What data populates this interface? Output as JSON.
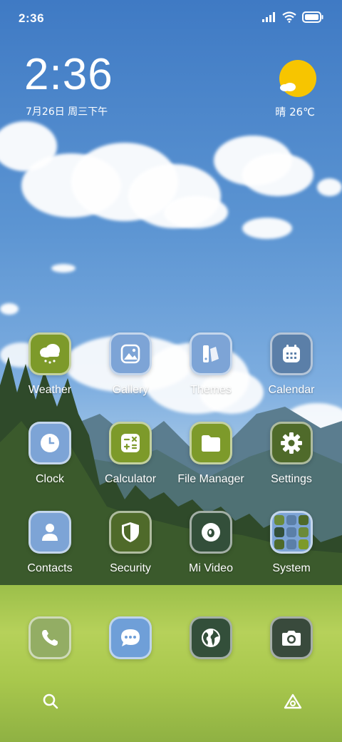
{
  "status_bar": {
    "time": "2:36",
    "icons": [
      "signal-icon",
      "wifi-icon",
      "battery-icon"
    ]
  },
  "clock_widget": {
    "time": "2:36",
    "date": "7月26日 周三下午"
  },
  "weather_widget": {
    "condition_icon": "sun-cloud-icon",
    "text": "晴 26℃"
  },
  "apps": [
    {
      "label": "Weather",
      "icon": "weather-icon",
      "color": "#7d9a2a"
    },
    {
      "label": "Gallery",
      "icon": "gallery-icon",
      "color": "#7da4d6"
    },
    {
      "label": "Themes",
      "icon": "themes-icon",
      "color": "#7da4d6"
    },
    {
      "label": "Calendar",
      "icon": "calendar-icon",
      "color": "#5b7fa8"
    },
    {
      "label": "Clock",
      "icon": "clock-icon",
      "color": "#7da4d6"
    },
    {
      "label": "Calculator",
      "icon": "calculator-icon",
      "color": "#7d9a2a"
    },
    {
      "label": "File Manager",
      "icon": "folder-icon",
      "color": "#7d9a2a"
    },
    {
      "label": "Settings",
      "icon": "gear-icon",
      "color": "#4f6a2a"
    },
    {
      "label": "Contacts",
      "icon": "contacts-icon",
      "color": "#7da4d6"
    },
    {
      "label": "Security",
      "icon": "shield-icon",
      "color": "#4f6a2a"
    },
    {
      "label": "Mi Video",
      "icon": "video-icon",
      "color": "#334f3a"
    },
    {
      "label": "System",
      "icon": "folder-grid-icon",
      "color": "#7da4d6"
    }
  ],
  "dock": [
    {
      "icon": "phone-icon",
      "color": "#93ad64"
    },
    {
      "icon": "messages-icon",
      "color": "#6f9fd8"
    },
    {
      "icon": "browser-globe-icon",
      "color": "#334f3a"
    },
    {
      "icon": "camera-icon",
      "color": "#394a3c"
    }
  ],
  "bottom_bar": {
    "left_icon": "search-icon",
    "right_icon": "launcher-icon"
  }
}
